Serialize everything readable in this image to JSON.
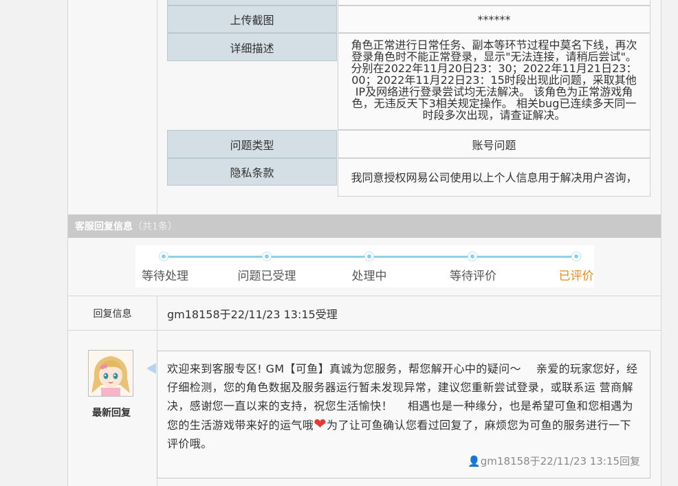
{
  "form_rows": [
    {
      "label": "上传截图",
      "value": "******"
    },
    {
      "label": "详细描述",
      "value": "角色正常进行日常任务、副本等环节过程中莫名下线，再次登录角色时不能正常登录，显示\"无法连接，请稍后尝试\"。 分别在2022年11月20日23：30；2022年11月21日23：00；2022年11月22日23：15时段出现此问题，采取其他IP及网络进行登录尝试均无法解决。 该角色为正常游戏角色，无违反天下3相关规定操作。 相关bug已连续多天同一时段多次出现，请查证解决。"
    },
    {
      "label": "问题类型",
      "value": "账号问题"
    },
    {
      "label": "隐私条款",
      "value": "我同意授权网易公司使用以上个人信息用于解决用户咨询，"
    }
  ],
  "reply_section": {
    "title": "客服回复信息",
    "count": "（共1条）"
  },
  "progress_steps": [
    "等待处理",
    "问题已受理",
    "处理中",
    "等待评价",
    "已评价"
  ],
  "progress_current": "已评价",
  "reply_info": {
    "label": "回复信息",
    "text": "gm18158于22/11/23 13:15受理"
  },
  "latest_reply": {
    "caption": "最新回复",
    "message_part1": "欢迎来到客服专区! GM【可鱼】真诚为您服务，帮您解开心中的疑问～　 亲爱的玩家您好，经仔细检测，您的角色数据及服务器运行暂未发现异常，建议您重新尝试登录，或联系运 营商解决，感谢您一直以来的支持，祝您生活愉快！　 相遇也是一种缘分，也是希望可鱼和您相遇为您的生活游戏带来好的运气哦",
    "message_part2": "为了让可鱼确认您看过回复了，麻烦您为可鱼的服务进行一下评价哦。",
    "footer": "gm18158于22/11/23 13:15回复"
  },
  "colors": {
    "label_bg": "#d3dee5",
    "section_bar": "#c9c9c9",
    "progress_line": "#8ecfea",
    "done_step": "#e08a1f"
  }
}
